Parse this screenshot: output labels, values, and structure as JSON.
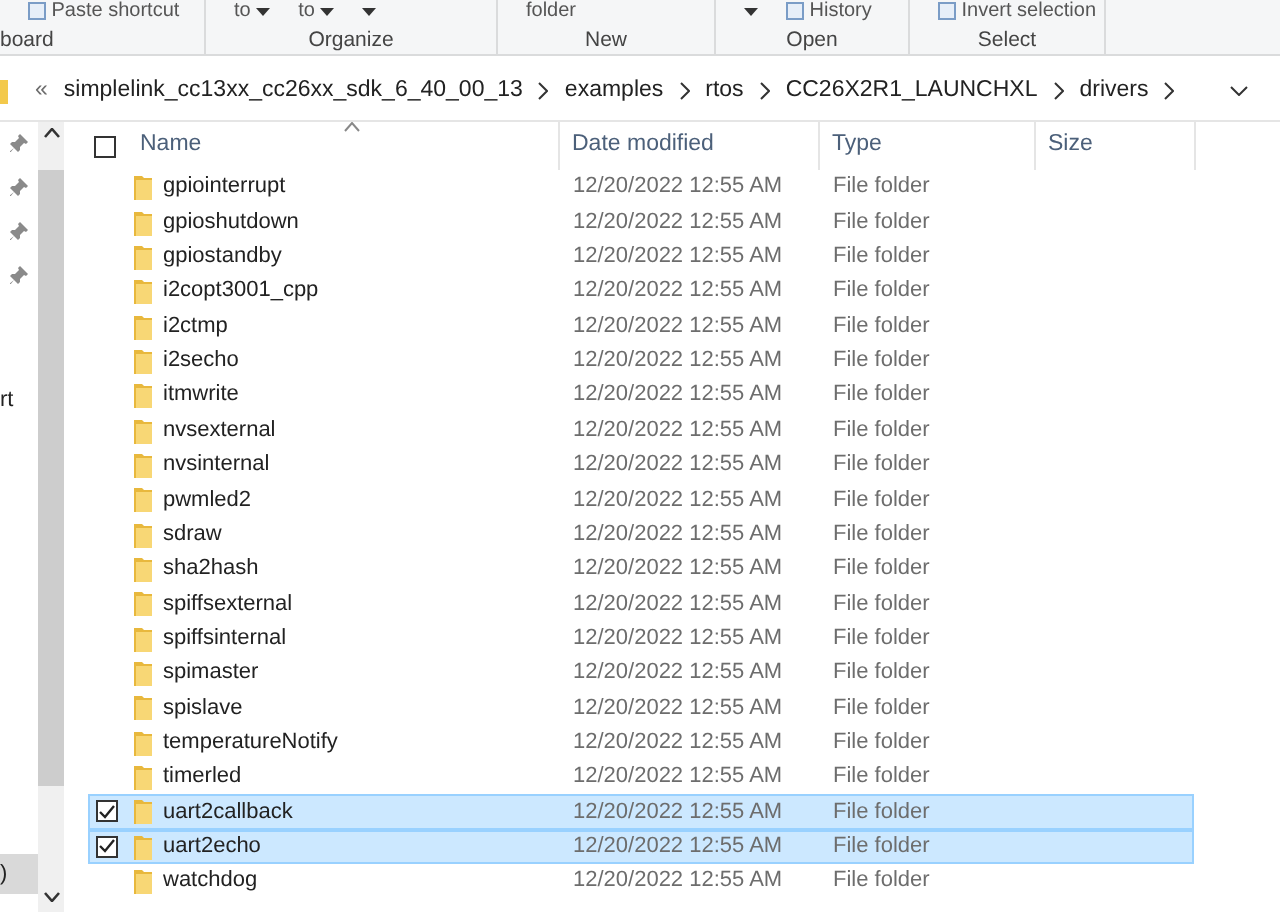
{
  "ribbon": {
    "groups": [
      {
        "label": "board",
        "items": [
          {
            "kind": "icon-text",
            "text": "Paste shortcut"
          }
        ]
      },
      {
        "label": "Organize",
        "items": [
          {
            "kind": "dropdown",
            "text": "to"
          },
          {
            "kind": "dropdown",
            "text": "to"
          },
          {
            "kind": "dropdown"
          }
        ]
      },
      {
        "label": "New",
        "items": [
          {
            "kind": "text",
            "text": "folder"
          }
        ]
      },
      {
        "label": "Open",
        "items": [
          {
            "kind": "dropdown"
          },
          {
            "kind": "icon-text",
            "text": "History"
          }
        ]
      },
      {
        "label": "Select",
        "items": [
          {
            "kind": "icon-text",
            "text": "Invert selection"
          }
        ]
      }
    ]
  },
  "address_bar": {
    "overflow": "«",
    "segments": [
      "simplelink_cc13xx_cc26xx_sdk_6_40_00_13",
      "examples",
      "rtos",
      "CC26X2R1_LAUNCHXL",
      "drivers"
    ]
  },
  "nav_pane": {
    "items": [
      {
        "text": "rt",
        "selected": false
      },
      {
        "text": ")",
        "selected": true
      }
    ]
  },
  "columns": [
    {
      "label": "Name",
      "sorted": true
    },
    {
      "label": "Date modified",
      "sorted": false
    },
    {
      "label": "Type",
      "sorted": false
    },
    {
      "label": "Size",
      "sorted": false
    }
  ],
  "select_all_checked": false,
  "rows": [
    {
      "name": "gpiointerrupt",
      "date": "12/20/2022 12:55 AM",
      "type": "File folder",
      "selected": false
    },
    {
      "name": "gpioshutdown",
      "date": "12/20/2022 12:55 AM",
      "type": "File folder",
      "selected": false
    },
    {
      "name": "gpiostandby",
      "date": "12/20/2022 12:55 AM",
      "type": "File folder",
      "selected": false
    },
    {
      "name": "i2copt3001_cpp",
      "date": "12/20/2022 12:55 AM",
      "type": "File folder",
      "selected": false
    },
    {
      "name": "i2ctmp",
      "date": "12/20/2022 12:55 AM",
      "type": "File folder",
      "selected": false
    },
    {
      "name": "i2secho",
      "date": "12/20/2022 12:55 AM",
      "type": "File folder",
      "selected": false
    },
    {
      "name": "itmwrite",
      "date": "12/20/2022 12:55 AM",
      "type": "File folder",
      "selected": false
    },
    {
      "name": "nvsexternal",
      "date": "12/20/2022 12:55 AM",
      "type": "File folder",
      "selected": false
    },
    {
      "name": "nvsinternal",
      "date": "12/20/2022 12:55 AM",
      "type": "File folder",
      "selected": false
    },
    {
      "name": "pwmled2",
      "date": "12/20/2022 12:55 AM",
      "type": "File folder",
      "selected": false
    },
    {
      "name": "sdraw",
      "date": "12/20/2022 12:55 AM",
      "type": "File folder",
      "selected": false
    },
    {
      "name": "sha2hash",
      "date": "12/20/2022 12:55 AM",
      "type": "File folder",
      "selected": false
    },
    {
      "name": "spiffsexternal",
      "date": "12/20/2022 12:55 AM",
      "type": "File folder",
      "selected": false
    },
    {
      "name": "spiffsinternal",
      "date": "12/20/2022 12:55 AM",
      "type": "File folder",
      "selected": false
    },
    {
      "name": "spimaster",
      "date": "12/20/2022 12:55 AM",
      "type": "File folder",
      "selected": false
    },
    {
      "name": "spislave",
      "date": "12/20/2022 12:55 AM",
      "type": "File folder",
      "selected": false
    },
    {
      "name": "temperatureNotify",
      "date": "12/20/2022 12:55 AM",
      "type": "File folder",
      "selected": false
    },
    {
      "name": "timerled",
      "date": "12/20/2022 12:55 AM",
      "type": "File folder",
      "selected": false
    },
    {
      "name": "uart2callback",
      "date": "12/20/2022 12:55 AM",
      "type": "File folder",
      "selected": true
    },
    {
      "name": "uart2echo",
      "date": "12/20/2022 12:55 AM",
      "type": "File folder",
      "selected": true
    },
    {
      "name": "watchdog",
      "date": "12/20/2022 12:55 AM",
      "type": "File folder",
      "selected": false
    }
  ]
}
